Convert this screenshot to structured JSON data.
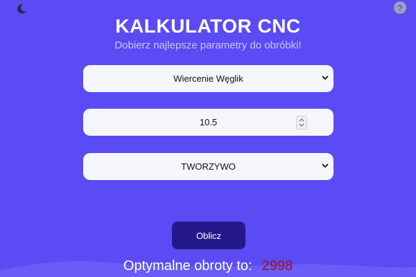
{
  "header": {
    "theme_icon": "moon-icon",
    "help_icon": "question-circle-icon",
    "help_glyph": "?",
    "title": "KALKULATOR CNC",
    "subtitle": "Dobierz najlepsze parametry do obróbki!"
  },
  "form": {
    "operation_select": {
      "value": "Wiercenie Węglik"
    },
    "diameter_input": {
      "value": "10.5"
    },
    "material_select": {
      "value": "TWORZYWO"
    }
  },
  "actions": {
    "calculate_label": "Oblicz"
  },
  "result": {
    "label": "Optymalne obroty to:",
    "value": "2998"
  },
  "colors": {
    "background": "#5b4bf5",
    "button": "#25188a",
    "result_value": "#a30f1a",
    "field": "#f5f6fb"
  }
}
